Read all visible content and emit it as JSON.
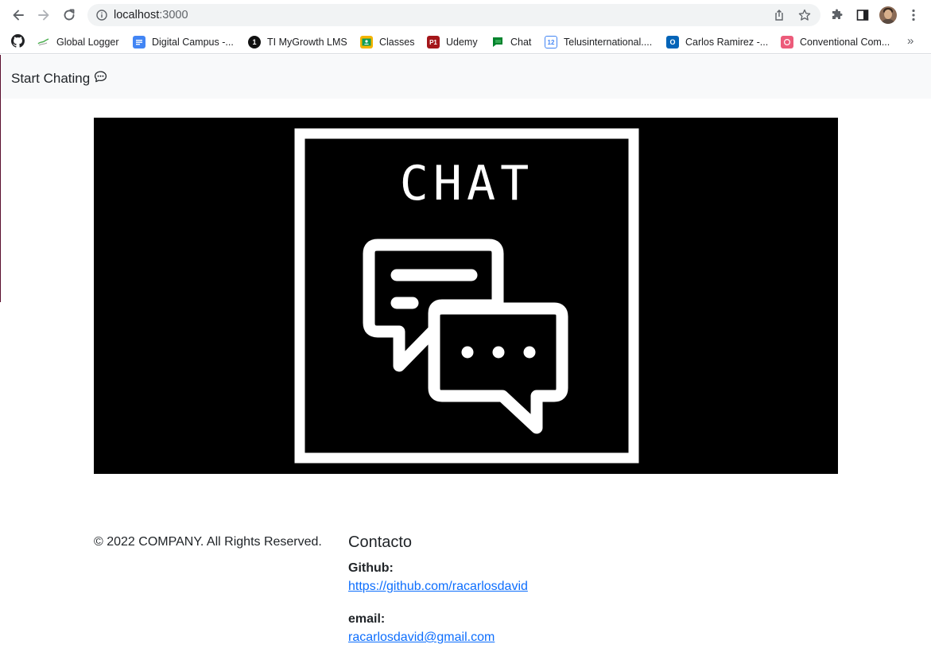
{
  "browser": {
    "url_host": "localhost",
    "url_port": ":3000",
    "bookmarks": [
      {
        "label": "Global Logger",
        "icon": "global-logger-icon"
      },
      {
        "label": "Digital Campus -...",
        "icon": "google-docs-icon"
      },
      {
        "label": "TI MyGrowth LMS",
        "icon": "mygrowth-icon"
      },
      {
        "label": "Classes",
        "icon": "google-classroom-icon"
      },
      {
        "label": "Udemy",
        "icon": "udemy-icon"
      },
      {
        "label": "Chat",
        "icon": "google-chat-icon"
      },
      {
        "label": "Telusinternational....",
        "icon": "google-calendar-icon"
      },
      {
        "label": "Carlos Ramirez -...",
        "icon": "outlook-icon"
      },
      {
        "label": "Conventional Com...",
        "icon": "conventional-icon"
      }
    ],
    "more_label": "»"
  },
  "navbar": {
    "brand": "Start Chating"
  },
  "hero": {
    "title": "CHAT"
  },
  "footer": {
    "copyright": "© 2022 COMPANY. All Rights Reserved.",
    "contact_title": "Contacto",
    "github_label": "Github:",
    "github_link": "https://github.com/racarlosdavid",
    "email_label": "email:",
    "email_link": "racarlosdavid@gmail.com"
  },
  "colors": {
    "link": "#0d6efd",
    "navbar_bg": "#f8f9fa",
    "hero_bg": "#000000"
  }
}
